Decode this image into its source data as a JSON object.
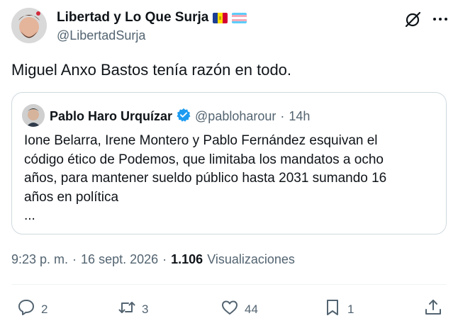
{
  "author": {
    "name": "Libertad y Lo Que Surja",
    "handle": "@LibertadSurja"
  },
  "post": {
    "text": "Miguel Anxo Bastos tenía razón en todo."
  },
  "quoted": {
    "name": "Pablo Haro Urquízar",
    "handle": "@pabloharour",
    "separator": "·",
    "time": "14h",
    "lines": [
      "Ione Belarra, Irene Montero y Pablo Fernández esquivan el",
      "código ético de Podemos, que limitaba los mandatos a ocho",
      "años, para mantener sueldo público hasta 2031 sumando 16",
      "años en política",
      "..."
    ]
  },
  "meta": {
    "time": "9:23 p. m.",
    "sep1": "·",
    "date": "16 sept. 2026",
    "sep2": "·",
    "views_count": "1.106",
    "views_label": "Visualizaciones"
  },
  "actions": {
    "replies": "2",
    "reposts": "3",
    "likes": "44",
    "bookmarks": "1"
  },
  "colors": {
    "verified": "#1d9bf0",
    "muted": "#536471",
    "border": "#cfd9de"
  },
  "icons": [
    "grok-icon",
    "more-icon",
    "reply-icon",
    "repost-icon",
    "like-icon",
    "bookmark-icon",
    "share-icon",
    "verified-badge-icon"
  ]
}
